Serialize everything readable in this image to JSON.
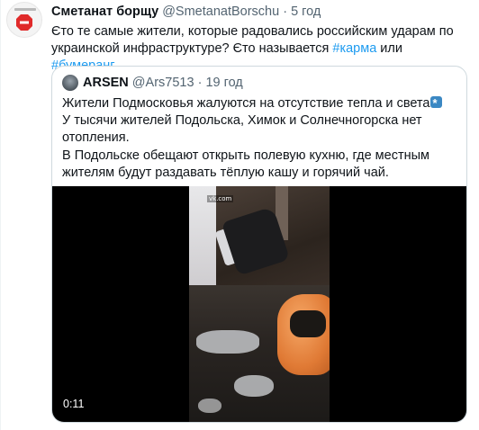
{
  "tweet": {
    "author_name": "Сметанат борщу",
    "author_handle": "@SmetanatBorschu",
    "separator": "·",
    "time": "5 год",
    "text_part1": "Єто те самые жители, которые радовались российским ударам по украинской инфраструктуре? Єто называется ",
    "hashtag1": "#карма",
    "text_part2": " или ",
    "hashtag2": "#бумеранг"
  },
  "quoted_tweet": {
    "author_name": "ARSEN",
    "author_handle": "@Ars7513",
    "separator": "·",
    "time": "19 год",
    "line1": "Жители Подмосковья жалуются на отсутствие тепла и света",
    "line2": "У тысячи жителей Подольска, Химок и Солнечногорска нет отопления.",
    "line3": "В Подольске обещают открыть полевую кухню, где местным жителям будут раздавать тёплую кашу и горячий чай.",
    "emoji": "snowflake-emoji",
    "video": {
      "duration": "0:11",
      "watermark": "vk.com"
    }
  },
  "colors": {
    "text": "#0f1419",
    "secondary": "#536471",
    "link": "#1d9bf0",
    "border": "#cfd9de"
  }
}
